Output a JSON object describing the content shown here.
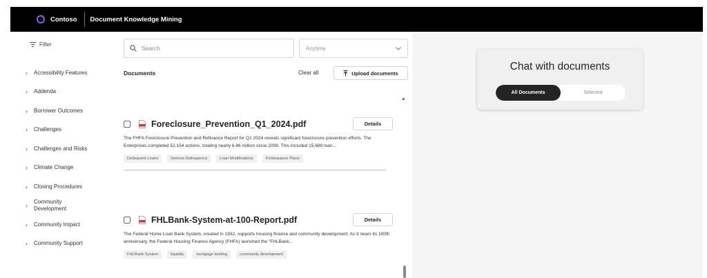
{
  "header": {
    "brand": "Contoso",
    "title": "Document Knowledge Mining"
  },
  "sidebar": {
    "filter_label": "Filter",
    "items": [
      {
        "label": "Accessibility Features"
      },
      {
        "label": "Addenda"
      },
      {
        "label": "Borrower Outcomes"
      },
      {
        "label": "Challenges"
      },
      {
        "label": "Challenges and Risks"
      },
      {
        "label": "Climate Change"
      },
      {
        "label": "Closing Procedures"
      },
      {
        "label": "Community Development"
      },
      {
        "label": "Community Impact"
      },
      {
        "label": "Community Support"
      }
    ]
  },
  "search": {
    "placeholder": "Search",
    "date_filter": "Anytime"
  },
  "documents": {
    "heading": "Documents",
    "clear_all": "Clear all",
    "upload_label": "Upload documents",
    "details_label": "Details",
    "items": [
      {
        "title": "Foreclosure_Prevention_Q1_2024.pdf",
        "description": "The FHFA Foreclosure Prevention and Refinance Report for Q1 2024 reveals significant foreclosure prevention efforts. The Enterprises completed 52,154 actions, totaling nearly 6.96 million since 2008. This included 15,689 loan...",
        "tags": [
          "Delinquent Loans",
          "Serious Delinquency",
          "Loan Modifications",
          "Forbearance Plans"
        ]
      },
      {
        "title": "FHLBank-System-at-100-Report.pdf",
        "description": "The Federal Home Loan Bank System, created in 1932, supports housing finance and community development. As it nears its 100th anniversary, the Federal Housing Finance Agency (FHFA) launched the \"FHLBank...",
        "tags": [
          "FHLBank System",
          "liquidity",
          "mortgage lending",
          "community development"
        ]
      }
    ]
  },
  "chat": {
    "title": "Chat with documents",
    "options": [
      {
        "label": "All Documents",
        "active": true
      },
      {
        "label": "Selected",
        "active": false
      }
    ]
  },
  "colors": {
    "header_bg": "#000000",
    "accent": "#242424",
    "panel_bg": "#f5f5f5",
    "pdf_red": "#d13438"
  }
}
